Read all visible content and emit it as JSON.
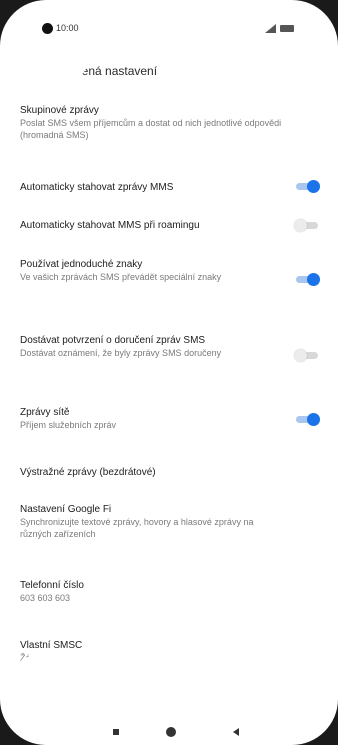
{
  "status_bar": {
    "time": "10:00"
  },
  "app_bar": {
    "title": "Rozšířená nastavení"
  },
  "settings": [
    {
      "id": "group-messages",
      "title": "Skupinové zprávy",
      "summary": "Poslat SMS všem příjemcům a dostat od nich jednotlivé odpovědi (hromadná SMS)"
    },
    {
      "id": "auto-download-mms",
      "title": "Automaticky stahovat zprávy MMS",
      "toggle": "on"
    },
    {
      "id": "auto-download-mms-roaming",
      "title": "Automaticky stahovat MMS při roamingu",
      "toggle": "off"
    },
    {
      "id": "simple-characters",
      "title": "Používat jednoduché znaky",
      "summary": "Ve vašich zprávách SMS převádět speciální znaky",
      "toggle": "on"
    },
    {
      "id": "sms-delivery-reports",
      "title": "Dostávat potvrzení o doručení zpráv SMS",
      "summary": "Dostávat oznámení, že byly zprávy SMS doručeny",
      "toggle": "off"
    },
    {
      "id": "cell-broadcast",
      "title": "Zprávy sítě",
      "summary": "Příjem služebních zpráv",
      "toggle": "on"
    },
    {
      "id": "wireless-alerts",
      "title": "Výstražné zprávy (bezdrátové)"
    },
    {
      "id": "google-fi-settings",
      "title": "Nastavení Google Fi",
      "summary": "Synchronizujte textové zprávy, hovory a hlasové zprávy na různých zařízeních"
    },
    {
      "id": "phone-number",
      "title": "Telefonní číslo",
      "summary": "603 603 603"
    },
    {
      "id": "own-smsc",
      "title": "Vlastní SMSC",
      "summary": "Žádné"
    }
  ],
  "colors": {
    "toggle_on": "#1a73e8",
    "toggle_on_track": "#a9c6ee",
    "toggle_off": "#ececec",
    "toggle_off_track": "#d8d8d8",
    "title_text": "#202020",
    "summary_text": "#7a7a7a"
  },
  "icons": {
    "back": "arrow-left-icon",
    "signal": "signal-icon",
    "battery": "battery-icon",
    "nav_recents": "recents-square-icon",
    "nav_home": "home-circle-icon",
    "nav_back": "back-triangle-icon"
  }
}
